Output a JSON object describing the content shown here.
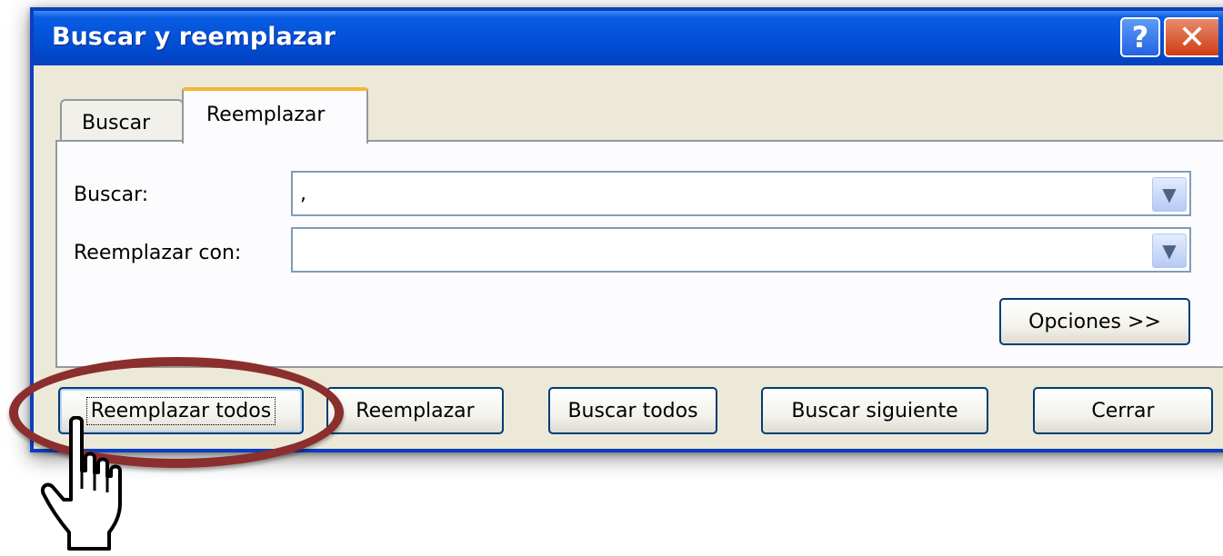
{
  "window": {
    "title": "Buscar y reemplazar"
  },
  "titlebar_buttons": {
    "help": "?",
    "close": "✕"
  },
  "tabs": [
    {
      "label": "Buscar",
      "active": false
    },
    {
      "label": "Reemplazar",
      "active": true
    }
  ],
  "fields": {
    "find": {
      "label": "Buscar:",
      "value": ","
    },
    "replace": {
      "label": "Reemplazar con:",
      "value": ""
    }
  },
  "buttons": {
    "options": "Opciones >>",
    "replace_all": "Reemplazar todos",
    "replace": "Reemplazar",
    "find_all": "Buscar todos",
    "find_next": "Buscar siguiente",
    "close": "Cerrar"
  },
  "icons": {
    "dropdown": "chevron-down-icon",
    "cursor": "hand-pointer-icon"
  },
  "colors": {
    "titlebar": "#0351d8",
    "dialog_bg": "#ece9d8",
    "annotation": "#8b2e2e",
    "active_tab_accent": "#f8b534"
  }
}
